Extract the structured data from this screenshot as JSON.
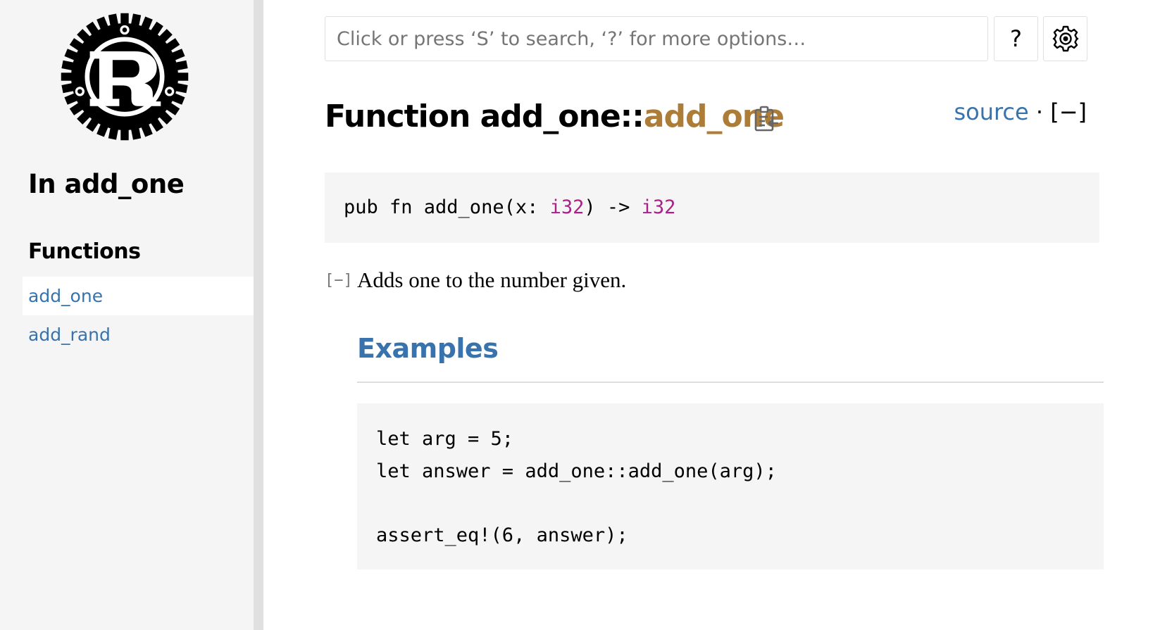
{
  "sidebar": {
    "crate_heading": "In add_one",
    "section_title": "Functions",
    "items": [
      {
        "label": "add_one",
        "current": true
      },
      {
        "label": "add_rand",
        "current": false
      }
    ]
  },
  "search": {
    "placeholder": "Click or press ‘S’ to search, ‘?’ for more options…",
    "help_label": "?"
  },
  "heading": {
    "prefix": "Function add_one::",
    "name": "add_one"
  },
  "out_of_band": {
    "source_label": "source",
    "separator": " · ",
    "toggle_label": "[−]"
  },
  "signature": {
    "part1": "pub fn add_one(x: ",
    "type1": "i32",
    "part2": ") -> ",
    "type2": "i32"
  },
  "docblock": {
    "toggle": "[−]",
    "summary": "Adds one to the number given.",
    "examples_heading": "Examples",
    "code_lines": [
      "let arg = 5;",
      "let answer = add_one::add_one(arg);",
      "",
      "assert_eq!(6, answer);"
    ]
  },
  "colors": {
    "link": "#3873ad",
    "fn_name": "#ad7c37",
    "primitive": "#ad1f8a",
    "sidebar_bg": "#f5f5f5",
    "code_bg": "#f5f5f5"
  }
}
